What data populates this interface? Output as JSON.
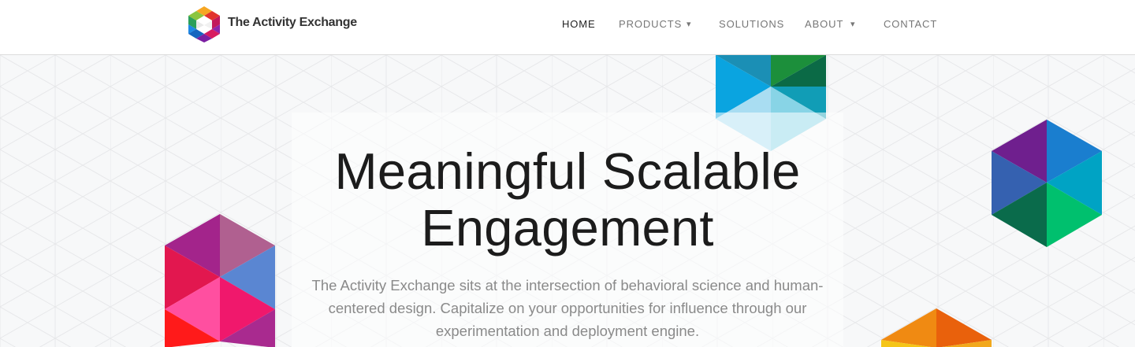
{
  "header": {
    "brand": "The Activity Exchange",
    "nav": {
      "home": "HOME",
      "products": "PRODUCTS",
      "solutions": "SOLUTIONS",
      "about": "ABOUT",
      "contact": "CONTACT",
      "dropdown_glyph": "▾"
    }
  },
  "hero": {
    "headline_line1": "Meaningful Scalable",
    "headline_line2": "Engagement",
    "subtitle": "The Activity Exchange sits at the intersection of behavioral science and human-centered design. Capitalize on your opportunities for influence through our experimentation and deployment engine."
  },
  "colors": {
    "background": "#f7f8f9",
    "header_bg": "#ffffff",
    "nav_active": "#222222",
    "nav_text": "#777777",
    "subtitle_text": "#8a8a8a"
  },
  "icons": [
    "logo-icon",
    "products-dropdown-icon",
    "about-dropdown-icon"
  ]
}
